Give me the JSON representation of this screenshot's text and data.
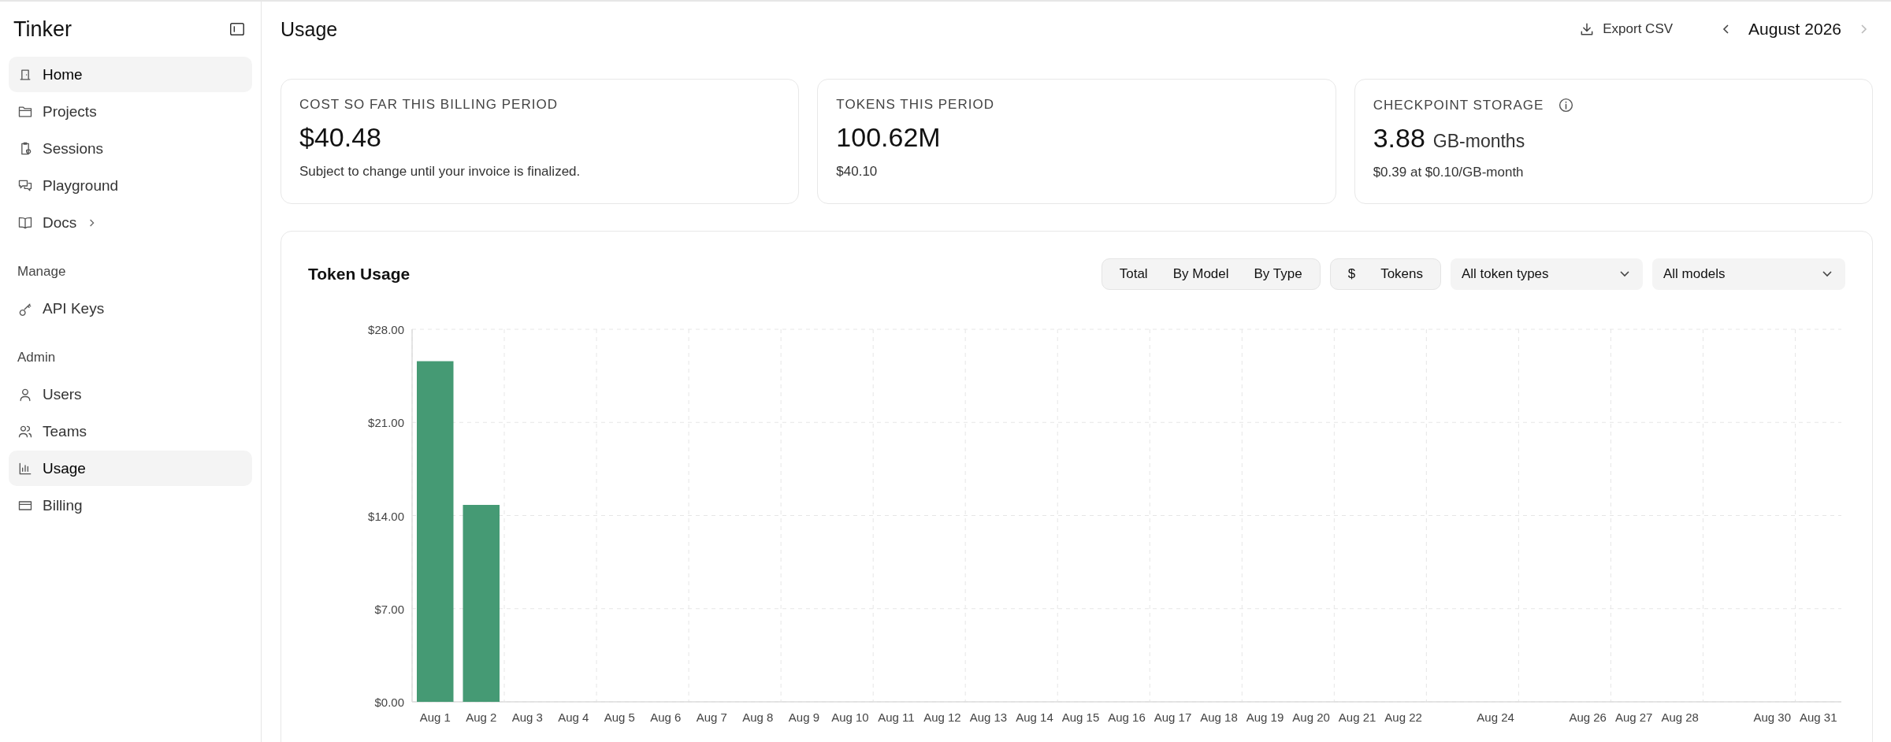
{
  "sidebar": {
    "title": "Tinker",
    "sections": [
      {
        "items": [
          {
            "label": "Home",
            "selected": true
          },
          {
            "label": "Projects",
            "selected": false
          },
          {
            "label": "Sessions",
            "selected": false
          },
          {
            "label": "Playground",
            "selected": false
          },
          {
            "label": "Docs",
            "selected": false,
            "expandable": true
          }
        ]
      },
      {
        "heading": "Manage",
        "items": [
          {
            "label": "API Keys",
            "selected": false
          }
        ]
      },
      {
        "heading": "Admin",
        "items": [
          {
            "label": "Users",
            "selected": false
          },
          {
            "label": "Teams",
            "selected": false
          },
          {
            "label": "Usage",
            "selected": true
          },
          {
            "label": "Billing",
            "selected": false
          }
        ]
      }
    ]
  },
  "header": {
    "title": "Usage",
    "export_label": "Export CSV",
    "period": "August 2026",
    "next_disabled": true
  },
  "cards": [
    {
      "label": "COST SO FAR THIS BILLING PERIOD",
      "value": "$40.48",
      "note": "Subject to change until your invoice is finalized."
    },
    {
      "label": "TOKENS THIS PERIOD",
      "value": "100.62M",
      "note": "$40.10"
    },
    {
      "label": "CHECKPOINT STORAGE",
      "info": true,
      "value": "3.88",
      "unit": "GB-months",
      "note": "$0.39 at $0.10/GB-month"
    }
  ],
  "token_usage": {
    "title": "Token Usage",
    "view_options": [
      {
        "label": "Total"
      },
      {
        "label": "By Model"
      },
      {
        "label": "By Type"
      }
    ],
    "unit_options": [
      {
        "label": "$"
      },
      {
        "label": "Tokens"
      }
    ],
    "filters": [
      {
        "value": "All token types"
      },
      {
        "value": "All models"
      }
    ],
    "chart_data": {
      "type": "bar",
      "grid": true,
      "categories": [
        "Aug 1",
        "Aug 2",
        "Aug 3",
        "Aug 4",
        "Aug 5",
        "Aug 6",
        "Aug 7",
        "Aug 8",
        "Aug 9",
        "Aug 10",
        "Aug 11",
        "Aug 12",
        "Aug 13",
        "Aug 14",
        "Aug 15",
        "Aug 16",
        "Aug 17",
        "Aug 18",
        "Aug 19",
        "Aug 20",
        "Aug 21",
        "Aug 22",
        null,
        "Aug 24",
        null,
        "Aug 26",
        "Aug 27",
        "Aug 28",
        null,
        "Aug 30",
        "Aug 31"
      ],
      "series": [
        {
          "color": "#459a74",
          "values": [
            25.6,
            14.8,
            0,
            0,
            0,
            0,
            0,
            0,
            0,
            0,
            0,
            0,
            0,
            0,
            0,
            0,
            0,
            0,
            0,
            0,
            0,
            0,
            0,
            0,
            0,
            0,
            0,
            0,
            0,
            0,
            0
          ]
        }
      ],
      "ylim": [
        0,
        28
      ],
      "yticks": [
        {
          "value": 0,
          "label": "$0.00"
        },
        {
          "value": 7,
          "label": "$7.00"
        },
        {
          "value": 14,
          "label": "$14.00"
        },
        {
          "value": 21,
          "label": "$21.00"
        },
        {
          "value": 28,
          "label": "$28.00"
        }
      ]
    }
  }
}
